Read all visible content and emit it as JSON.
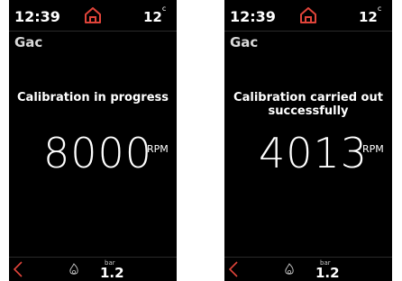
{
  "screens": [
    {
      "time": "12:39",
      "temp_value": "12",
      "temp_unit": "c",
      "page_title": "Gac",
      "status_lines": [
        "Calibration in progress",
        ""
      ],
      "rpm_value": "8000",
      "rpm_unit": "RPM",
      "pressure_unit": "bar",
      "pressure_value": "1.2"
    },
    {
      "time": "12:39",
      "temp_value": "12",
      "temp_unit": "c",
      "page_title": "Gac",
      "status_lines": [
        "Calibration carried out",
        "successfully"
      ],
      "rpm_value": "4013",
      "rpm_unit": "RPM",
      "pressure_unit": "bar",
      "pressure_value": "1.2"
    }
  ],
  "icons": {
    "home": "home-icon",
    "back": "back-arrow-icon",
    "flame": "flame-icon"
  },
  "colors": {
    "accent": "#e0443a",
    "background": "#000000",
    "text": "#ffffff"
  }
}
